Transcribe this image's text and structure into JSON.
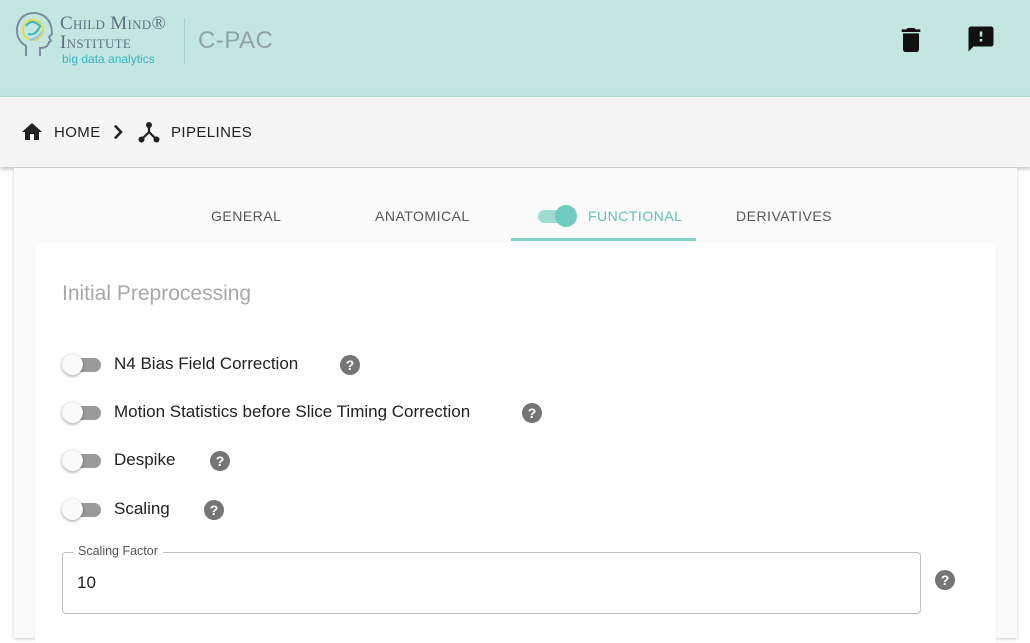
{
  "header": {
    "logo": {
      "line1": "Child Mind®",
      "line2": "Institute",
      "line3": "big data analytics"
    },
    "app_title": "C-PAC",
    "actions": [
      {
        "icon": "trash-icon"
      },
      {
        "icon": "feedback-icon"
      }
    ]
  },
  "breadcrumb": {
    "items": [
      {
        "label": "HOME",
        "icon": "home-icon"
      },
      {
        "label": "PIPELINES",
        "icon": "pipeline-icon"
      }
    ],
    "separator_icon": "chevron-right-icon"
  },
  "tabs": [
    {
      "label": "GENERAL",
      "active": false
    },
    {
      "label": "ANATOMICAL",
      "active": false
    },
    {
      "label": "FUNCTIONAL",
      "active": true,
      "enabled_toggle": true
    },
    {
      "label": "DERIVATIVES",
      "active": false
    }
  ],
  "section": {
    "title": "Initial Preprocessing",
    "options": [
      {
        "label": "N4 Bias Field Correction",
        "enabled": false
      },
      {
        "label": "Motion Statistics before Slice Timing Correction",
        "enabled": false
      },
      {
        "label": "Despike",
        "enabled": false
      },
      {
        "label": "Scaling",
        "enabled": false
      }
    ],
    "scaling_factor": {
      "label": "Scaling Factor",
      "value": "10"
    }
  },
  "help_glyph": "?",
  "colors": {
    "header_bg": "#c3e6e0",
    "accent": "#5fc2b7",
    "switch_off": "#9a9a9a",
    "help_bg": "#757575"
  }
}
